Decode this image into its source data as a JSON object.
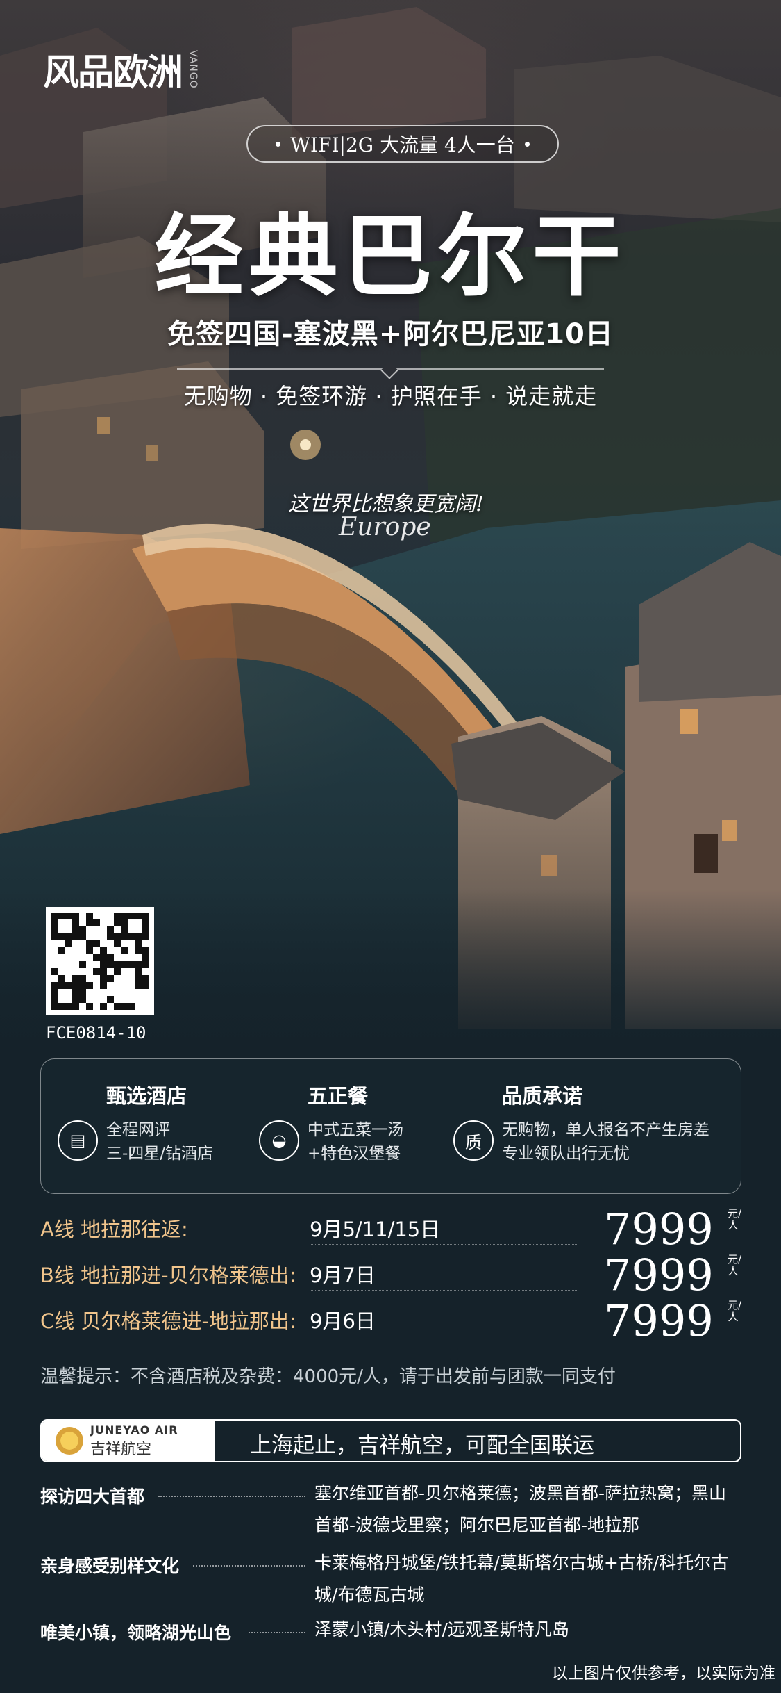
{
  "brand": {
    "logo_text": "风品欧洲",
    "logo_small": "VANGO"
  },
  "hero": {
    "wifi_pill": "WIFI|2G 大流量 4人一台",
    "title": "经典巴尔干",
    "subtitle": "免签四国-塞波黑+阿尔巴尼亚10日",
    "tagline": "无购物 · 免签环游 · 护照在手 · 说走就走",
    "slogan": "这世界比想象更宽阔!",
    "slogan_en": "Europe"
  },
  "qr": {
    "code": "FCE0814-10"
  },
  "features": [
    {
      "icon": "hotel-icon",
      "title": "甄选酒店",
      "lines": [
        "全程网评",
        "三-四星/钻酒店"
      ]
    },
    {
      "icon": "dining-bell-icon",
      "title": "五正餐",
      "lines": [
        "中式五菜一汤",
        "+特色汉堡餐"
      ]
    },
    {
      "icon": "quality-badge-icon",
      "title": "品质承诺",
      "lines": [
        "无购物，单人报名不产生房差",
        "专业领队出行无忧"
      ]
    }
  ],
  "routes": [
    {
      "name": "A线  地拉那往返:",
      "dates": "9月5/11/15日",
      "price": "7999",
      "unit": "元/人"
    },
    {
      "name": "B线  地拉那进-贝尔格莱德出:",
      "dates": "9月7日",
      "price": "7999",
      "unit": "元/人"
    },
    {
      "name": "C线  贝尔格莱德进-地拉那出:",
      "dates": "9月6日",
      "price": "7999",
      "unit": "元/人"
    }
  ],
  "tip": "温馨提示：不含酒店税及杂费：4000元/人，请于出发前与团款一同支付",
  "airline": {
    "en": "JUNEYAO AIR",
    "cn": "吉祥航空",
    "text": "上海起止，吉祥航空，可配全国联运"
  },
  "highlights": [
    {
      "title": "探访四大首都",
      "value": "塞尔维亚首都-贝尔格莱德；波黑首都-萨拉热窝；黑山首都-波德戈里察；阿尔巴尼亚首都-地拉那"
    },
    {
      "title": "亲身感受别样文化",
      "value": "卡莱梅格丹城堡/铁托幕/莫斯塔尔古城+古桥/科托尔古城/布德瓦古城"
    },
    {
      "title": "唯美小镇，领略湖光山色",
      "value": "泽蒙小镇/木头村/远观圣斯特凡岛"
    }
  ],
  "footnote": "以上图片仅供参考，以实际为准",
  "colors": {
    "background": "#15222a",
    "route_name": "#f1c58c",
    "bridge_glow": "#d68c46"
  }
}
